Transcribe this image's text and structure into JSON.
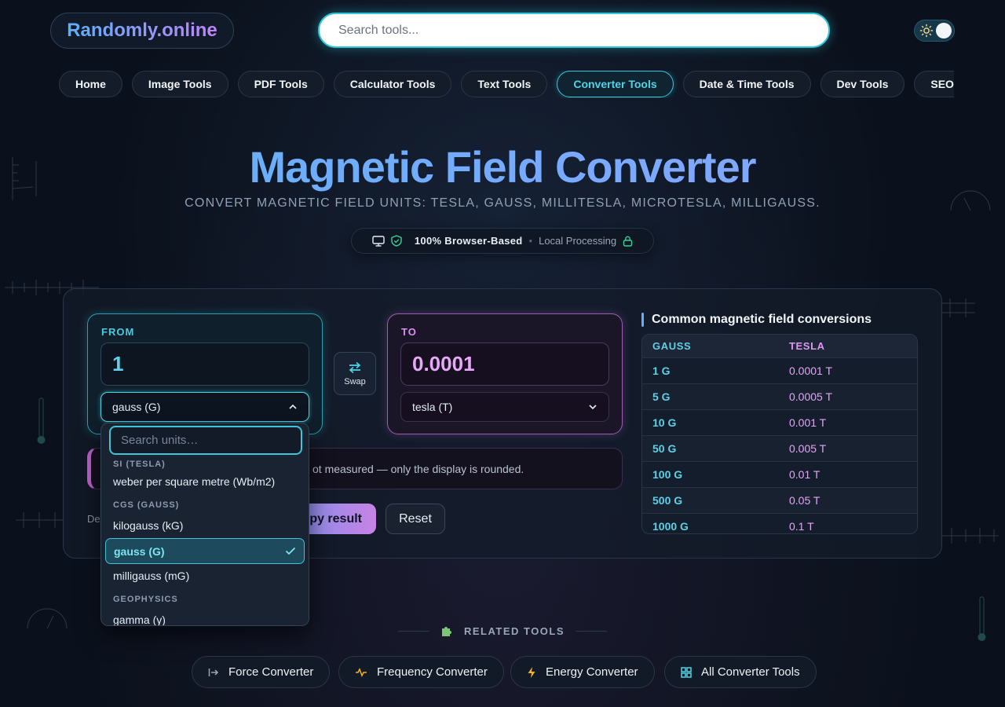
{
  "header": {
    "logo": "Randomly.online",
    "search_placeholder": "Search tools..."
  },
  "nav": [
    "Home",
    "Image Tools",
    "PDF Tools",
    "Calculator Tools",
    "Text Tools",
    "Converter Tools",
    "Date & Time Tools",
    "Dev Tools",
    "SEO Tools"
  ],
  "nav_active": "Converter Tools",
  "hero": {
    "title": "Magnetic Field Converter",
    "subtitle": "CONVERT MAGNETIC FIELD UNITS: TESLA, GAUSS, MILLITESLA, MICROTESLA, MILLIGAUSS.",
    "badge_main": "100% Browser-Based",
    "badge_secondary": "Local Processing"
  },
  "converter": {
    "from_label": "FROM",
    "from_value": "1",
    "from_unit": "gauss (G)",
    "to_label": "TO",
    "to_value": "0.0001",
    "to_unit": "tesla (T)",
    "swap_label": "Swap",
    "note_text": "ot measured — only the display is rounded.",
    "decimals_label": "De",
    "copy_label": "py result",
    "reset_label": "Reset"
  },
  "dropdown": {
    "search_placeholder": "Search units…",
    "groups": [
      {
        "name": "SI (TESLA)",
        "options": [
          "weber per square metre (Wb/m2)"
        ]
      },
      {
        "name": "CGS (GAUSS)",
        "options": [
          "kilogauss (kG)",
          "gauss (G)",
          "milligauss (mG)"
        ]
      },
      {
        "name": "GEOPHYSICS",
        "options": [
          "gamma (γ)"
        ]
      }
    ],
    "selected": "gauss (G)"
  },
  "table": {
    "title": "Common magnetic field conversions",
    "headers": [
      "GAUSS",
      "TESLA"
    ],
    "rows": [
      [
        "1 G",
        "0.0001 T"
      ],
      [
        "5 G",
        "0.0005 T"
      ],
      [
        "10 G",
        "0.001 T"
      ],
      [
        "50 G",
        "0.005 T"
      ],
      [
        "100 G",
        "0.01 T"
      ],
      [
        "500 G",
        "0.05 T"
      ],
      [
        "1000 G",
        "0.1 T"
      ]
    ]
  },
  "related": {
    "heading": "RELATED TOOLS",
    "items": [
      "Force Converter",
      "Frequency Converter",
      "Energy Converter",
      "All Converter Tools"
    ]
  },
  "colors": {
    "accent_cyan": "#2ec6d8",
    "accent_purple": "#c084fc"
  }
}
